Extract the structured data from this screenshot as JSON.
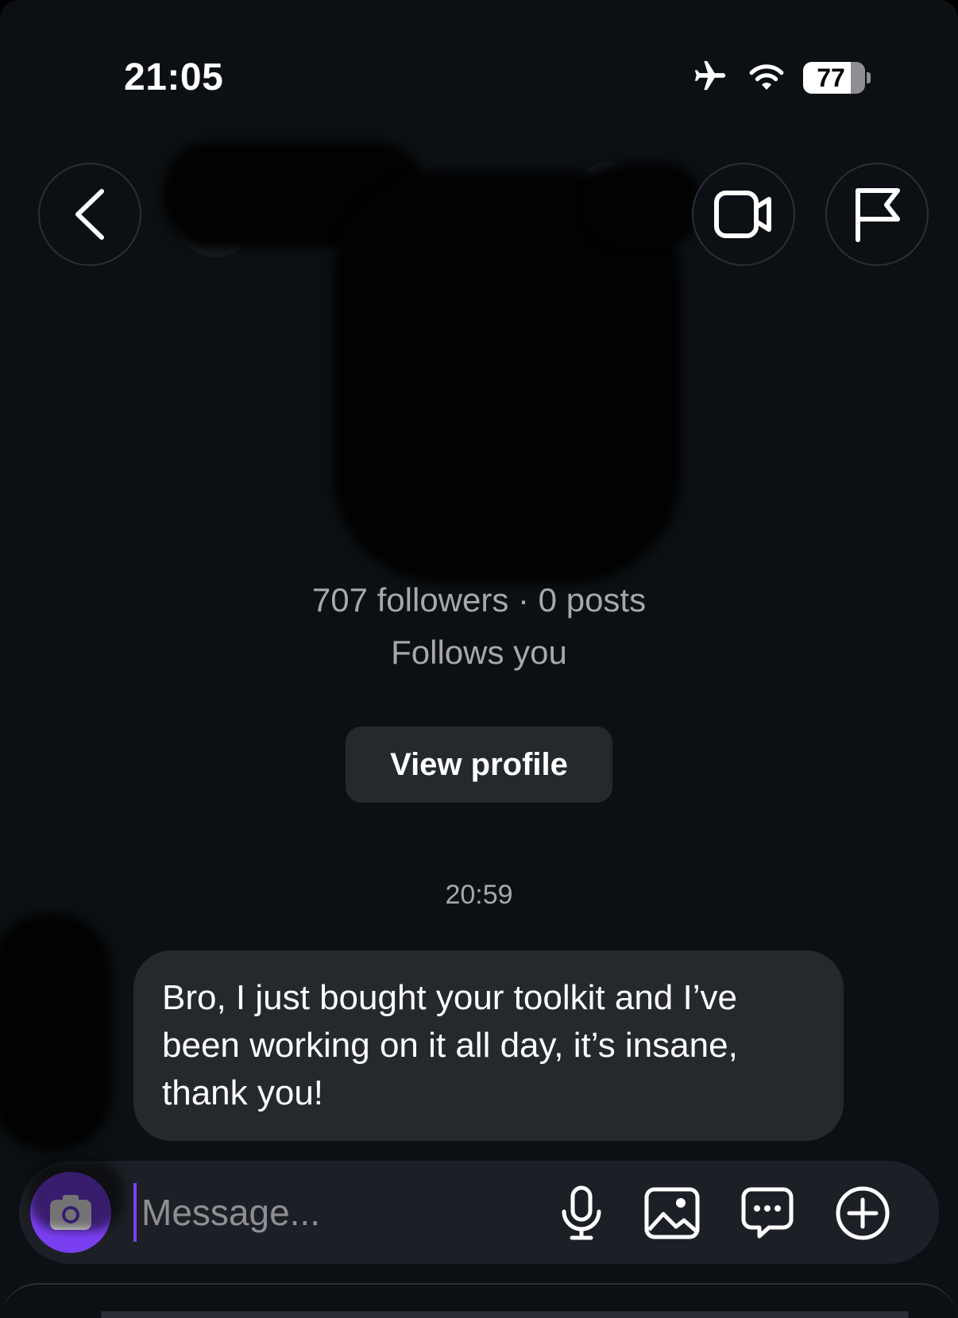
{
  "status_bar": {
    "time": "21:05",
    "battery_level": "77",
    "battery_fraction": 0.77,
    "icons": [
      "airplane-icon",
      "wifi-icon",
      "battery-icon"
    ]
  },
  "header": {
    "icons": [
      "chevron-left-icon",
      "video-camera-icon",
      "flag-icon"
    ]
  },
  "profile": {
    "followers_line": "707 followers · 0 posts",
    "follows_you": "Follows you",
    "view_profile_label": "View profile"
  },
  "conversation": {
    "timestamp": "20:59",
    "messages": [
      {
        "text": "Bro, I just bought your toolkit and I’ve been working on it all day, it’s insane, thank you!"
      }
    ]
  },
  "composer": {
    "placeholder": "Message...",
    "icons": [
      "camera-icon",
      "microphone-icon",
      "image-icon",
      "sticker-icon",
      "plus-circle-icon"
    ]
  },
  "colors": {
    "background": "#0c1014",
    "bubble": "#25292e",
    "accent": "#7b3ff2",
    "muted_text": "#a8a8a8"
  }
}
